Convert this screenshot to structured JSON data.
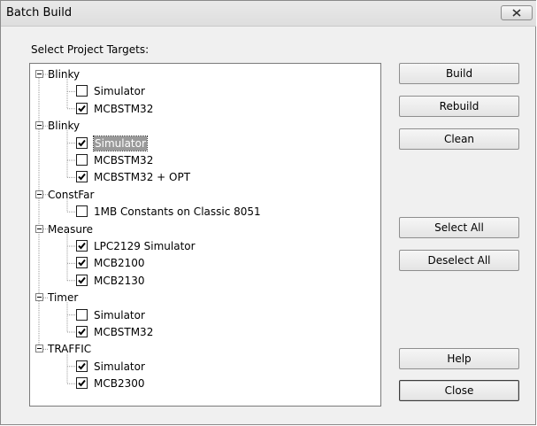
{
  "window": {
    "title": "Batch Build"
  },
  "section_label": "Select Project Targets:",
  "tree": [
    {
      "label": "Blinky",
      "children": [
        {
          "label": "Simulator",
          "checked": false,
          "selected": false
        },
        {
          "label": "MCBSTM32",
          "checked": true,
          "selected": false
        }
      ]
    },
    {
      "label": "Blinky",
      "children": [
        {
          "label": "Simulator",
          "checked": true,
          "selected": true
        },
        {
          "label": "MCBSTM32",
          "checked": false,
          "selected": false
        },
        {
          "label": "MCBSTM32 + OPT",
          "checked": true,
          "selected": false
        }
      ]
    },
    {
      "label": "ConstFar",
      "children": [
        {
          "label": "1MB Constants on Classic 8051",
          "checked": false,
          "selected": false
        }
      ]
    },
    {
      "label": "Measure",
      "children": [
        {
          "label": "LPC2129 Simulator",
          "checked": true,
          "selected": false
        },
        {
          "label": "MCB2100",
          "checked": true,
          "selected": false
        },
        {
          "label": "MCB2130",
          "checked": true,
          "selected": false
        }
      ]
    },
    {
      "label": "Timer",
      "children": [
        {
          "label": "Simulator",
          "checked": false,
          "selected": false
        },
        {
          "label": "MCBSTM32",
          "checked": true,
          "selected": false
        }
      ]
    },
    {
      "label": "TRAFFIC",
      "children": [
        {
          "label": "Simulator",
          "checked": true,
          "selected": false
        },
        {
          "label": "MCB2300",
          "checked": true,
          "selected": false
        }
      ]
    }
  ],
  "buttons": {
    "build": "Build",
    "rebuild": "Rebuild",
    "clean": "Clean",
    "select_all": "Select All",
    "deselect_all": "Deselect All",
    "help": "Help",
    "close": "Close"
  },
  "icons": {
    "title_close": "close-icon",
    "expander": "collapse-minus-icon",
    "check": "checkmark-icon"
  }
}
